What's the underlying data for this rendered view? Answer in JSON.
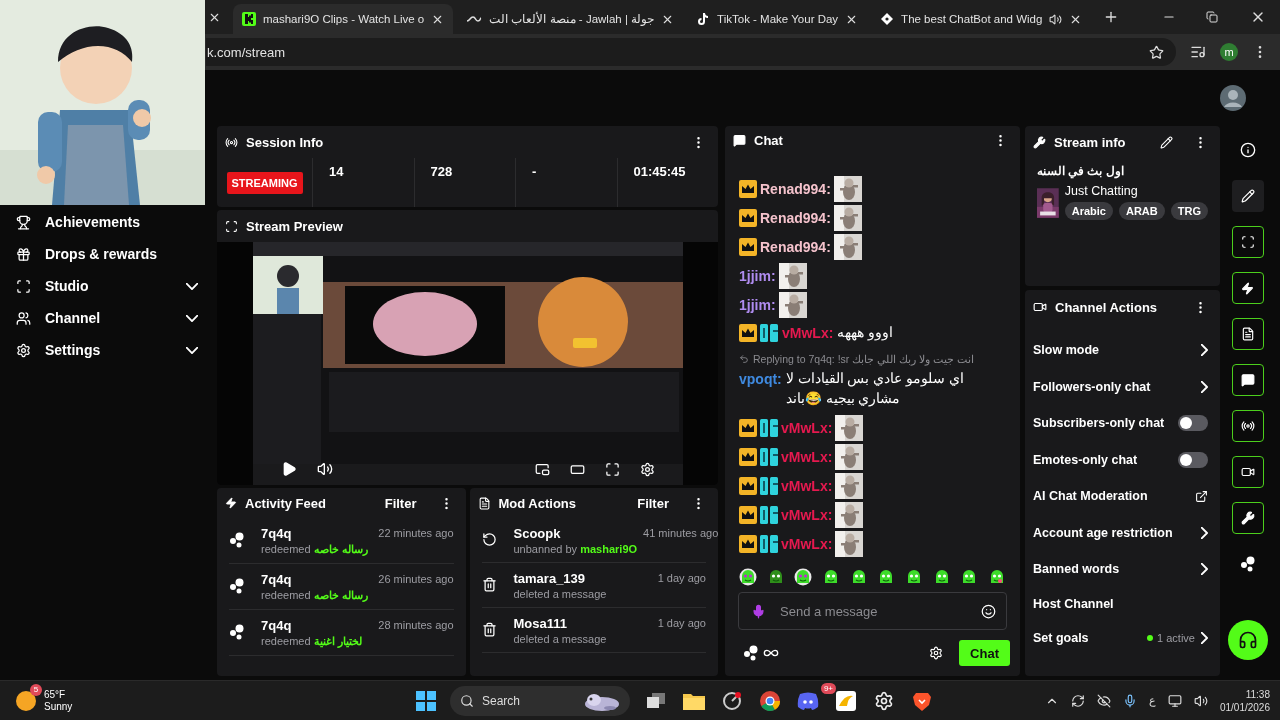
{
  "browser": {
    "tabs": [
      {
        "title": "mashari9O Clips - Watch Live o",
        "selected": true,
        "audio": false,
        "kind": "kick"
      },
      {
        "title": "جولة | Jawlah - منصة الألعاب الت",
        "selected": false,
        "audio": false,
        "kind": "jawlah"
      },
      {
        "title": "TikTok - Make Your Day",
        "selected": false,
        "audio": false,
        "kind": "tiktok"
      },
      {
        "title": "The best ChatBot and Widg",
        "selected": false,
        "audio": true,
        "kind": "bot"
      }
    ],
    "address": "k.com/stream",
    "profile_initial": "m"
  },
  "sidebar": {
    "items": [
      {
        "label": "Achievements",
        "kind": "trophy",
        "expandable": false
      },
      {
        "label": "Drops & rewards",
        "kind": "drops",
        "expandable": false
      },
      {
        "label": "Studio",
        "kind": "studio",
        "expandable": true
      },
      {
        "label": "Channel",
        "kind": "channel",
        "expandable": true
      },
      {
        "label": "Settings",
        "kind": "settings",
        "expandable": true
      }
    ]
  },
  "session_info": {
    "title": "Session Info",
    "status": "STREAMING",
    "stats": [
      "14",
      "728",
      "-",
      "01:45:45"
    ]
  },
  "stream_preview": {
    "title": "Stream Preview"
  },
  "activity_feed": {
    "title": "Activity Feed",
    "filter": "Filter",
    "items": [
      {
        "user": "7q4q",
        "time": "22 minutes ago",
        "action": "redeemed",
        "reward": "رساله خاصه"
      },
      {
        "user": "7q4q",
        "time": "26 minutes ago",
        "action": "redeemed",
        "reward": "رساله خاصه"
      },
      {
        "user": "7q4q",
        "time": "28 minutes ago",
        "action": "redeemed",
        "reward": "لختيار اغنية"
      }
    ]
  },
  "mod_actions": {
    "title": "Mod Actions",
    "filter": "Filter",
    "items": [
      {
        "kind": "unban",
        "user": "Scoopk",
        "time": "41 minutes ago",
        "action": "unbanned by",
        "by": "mashari9O"
      },
      {
        "kind": "delete",
        "user": "tamara_139",
        "time": "1 day ago",
        "action": "deleted a message"
      },
      {
        "kind": "delete",
        "user": "Mosa111",
        "time": "1 day ago",
        "action": "deleted a message"
      }
    ]
  },
  "chat": {
    "title": "Chat",
    "messages": [
      {
        "user": "Renad994:",
        "color": "#f4c2cc",
        "badges": [
          {
            "kind": "crown"
          }
        ],
        "kind": "sticker"
      },
      {
        "user": "Renad994:",
        "color": "#f4c2cc",
        "badges": [
          {
            "kind": "crown"
          }
        ],
        "kind": "sticker"
      },
      {
        "user": "Renad994:",
        "color": "#f4c2cc",
        "badges": [
          {
            "kind": "crown"
          }
        ],
        "kind": "sticker"
      },
      {
        "user": "1jjim:",
        "color": "#b08cf0",
        "kind": "sticker"
      },
      {
        "user": "1jjim:",
        "color": "#b08cf0",
        "kind": "sticker"
      },
      {
        "user": "vMwLx:",
        "color": "#e5194f",
        "badges": [
          {
            "kind": "crown"
          },
          {
            "kind": "og"
          }
        ],
        "kind": "text",
        "text": "اووو هههه"
      },
      {
        "user": "vpoqt:",
        "color": "#3f8ae0",
        "kind": "text",
        "reply": "Replying to 7q4q: !sr انت جيت ولا ربك اللي جابك",
        "text": "اي سلومو عادي بس القيادات لا مشاري بيجيه 😂باند"
      },
      {
        "user": "vMwLx:",
        "color": "#e5194f",
        "badges": [
          {
            "kind": "crown"
          },
          {
            "kind": "og"
          }
        ],
        "kind": "sticker"
      },
      {
        "user": "vMwLx:",
        "color": "#e5194f",
        "badges": [
          {
            "kind": "crown"
          },
          {
            "kind": "og"
          }
        ],
        "kind": "sticker"
      },
      {
        "user": "vMwLx:",
        "color": "#e5194f",
        "badges": [
          {
            "kind": "crown"
          },
          {
            "kind": "og"
          }
        ],
        "kind": "sticker"
      },
      {
        "user": "vMwLx:",
        "color": "#e5194f",
        "badges": [
          {
            "kind": "crown"
          },
          {
            "kind": "og"
          }
        ],
        "kind": "sticker"
      },
      {
        "user": "vMwLx:",
        "color": "#e5194f",
        "badges": [
          {
            "kind": "crown"
          },
          {
            "kind": "og"
          }
        ],
        "kind": "sticker"
      }
    ],
    "input": {
      "placeholder": "Send a message"
    },
    "send": "Chat"
  },
  "stream_info": {
    "title": "Stream info",
    "stream_title": "اول بث في السنه",
    "category": "Just Chatting",
    "tags": [
      "Arabic",
      "ARAB",
      "TRG"
    ]
  },
  "channel_actions": {
    "title": "Channel Actions",
    "items": [
      {
        "label": "Slow mode",
        "kind": "link"
      },
      {
        "label": "Followers-only chat",
        "kind": "link"
      },
      {
        "label": "Subscribers-only chat",
        "kind": "toggle",
        "on": false
      },
      {
        "label": "Emotes-only chat",
        "kind": "toggle",
        "on": false
      },
      {
        "label": "AI Chat Moderation",
        "kind": "external"
      },
      {
        "label": "Account age restriction",
        "kind": "link"
      },
      {
        "label": "Banned words",
        "kind": "link"
      },
      {
        "label": "Host Channel",
        "kind": "plain"
      },
      {
        "label": "Set goals",
        "kind": "link",
        "status": "1 active"
      }
    ]
  },
  "taskbar": {
    "weather": {
      "badge": "5",
      "temp": "65°F",
      "condition": "Sunny"
    },
    "search": "Search",
    "discord_badge": "9+",
    "input_method": "ع",
    "time": "11:38",
    "date": "01/01/2026"
  }
}
